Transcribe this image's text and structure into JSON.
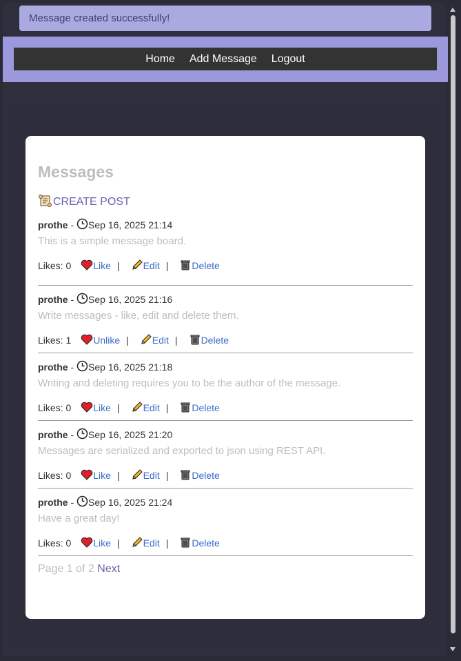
{
  "flash": "Message created successfully!",
  "nav": {
    "home": "Home",
    "add": "Add Message",
    "logout": "Logout"
  },
  "title": "Messages",
  "create_post": "CREATE POST",
  "messages": [
    {
      "author": "prothe",
      "time": "Sep 16, 2025 21:14",
      "text": "This is a simple message board.",
      "likes": "Likes: 0",
      "like_label": "Like",
      "edit": "Edit",
      "delete": "Delete"
    },
    {
      "author": "prothe",
      "time": "Sep 16, 2025 21:16",
      "text": "Write messages - like, edit and delete them.",
      "likes": "Likes: 1",
      "like_label": "Unlike",
      "edit": "Edit",
      "delete": "Delete"
    },
    {
      "author": "prothe",
      "time": "Sep 16, 2025 21:18",
      "text": "Writing and deleting requires you to be the author of the message.",
      "likes": "Likes: 0",
      "like_label": "Like",
      "edit": "Edit",
      "delete": "Delete"
    },
    {
      "author": "prothe",
      "time": "Sep 16, 2025 21:20",
      "text": "Messages are serialized and exported to json using REST API.",
      "likes": "Likes: 0",
      "like_label": "Like",
      "edit": "Edit",
      "delete": "Delete"
    },
    {
      "author": "prothe",
      "time": "Sep 16, 2025 21:24",
      "text": "Have a great day!",
      "likes": "Likes: 0",
      "like_label": "Like",
      "edit": "Edit",
      "delete": "Delete"
    }
  ],
  "pager": {
    "text": "Page 1 of 2",
    "next": "Next"
  },
  "colors": {
    "header": "#9b98db",
    "flash_bg": "#aaaae0",
    "link": "#3a6dc8",
    "accent": "#6a64a8"
  }
}
